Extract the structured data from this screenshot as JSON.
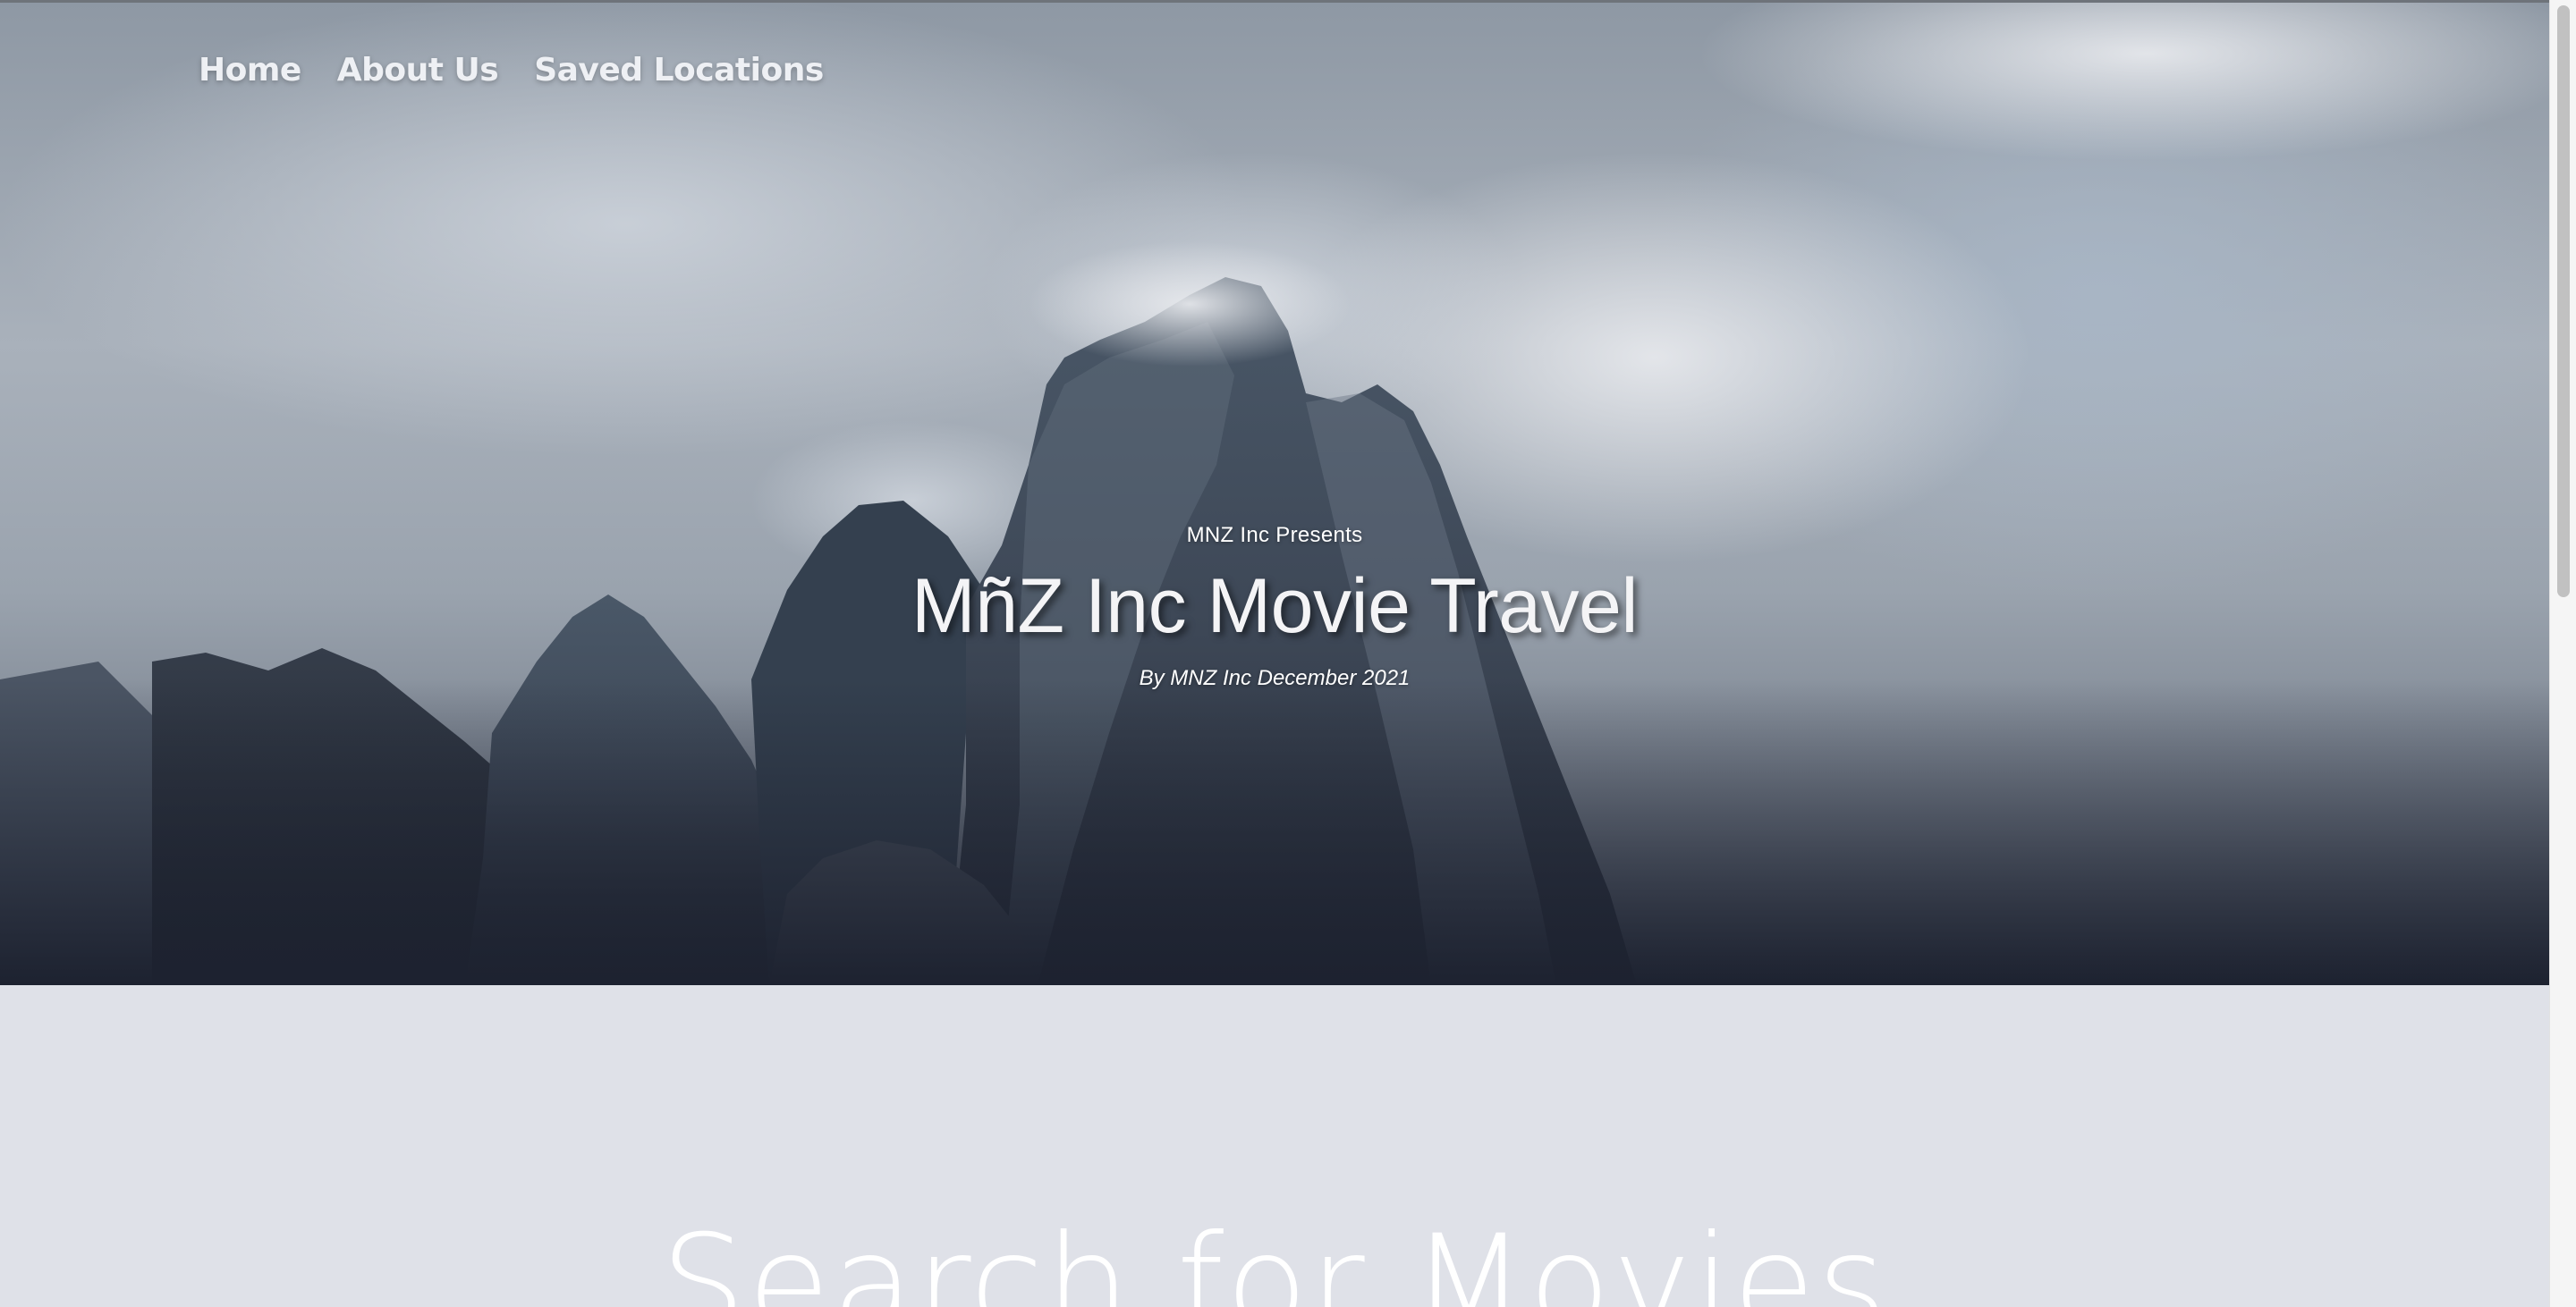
{
  "nav": {
    "home": "Home",
    "about": "About Us",
    "saved": "Saved Locations"
  },
  "hero": {
    "presents": "MNZ Inc Presents",
    "title": "MñZ Inc Movie Travel",
    "byline": "By MNZ Inc December 2021",
    "image": "mountain-peaks-in-clouds"
  },
  "search": {
    "heading": "Search for Movies"
  },
  "colors": {
    "content_background": "#dfe1e8",
    "hero_text": "#ffffff"
  }
}
